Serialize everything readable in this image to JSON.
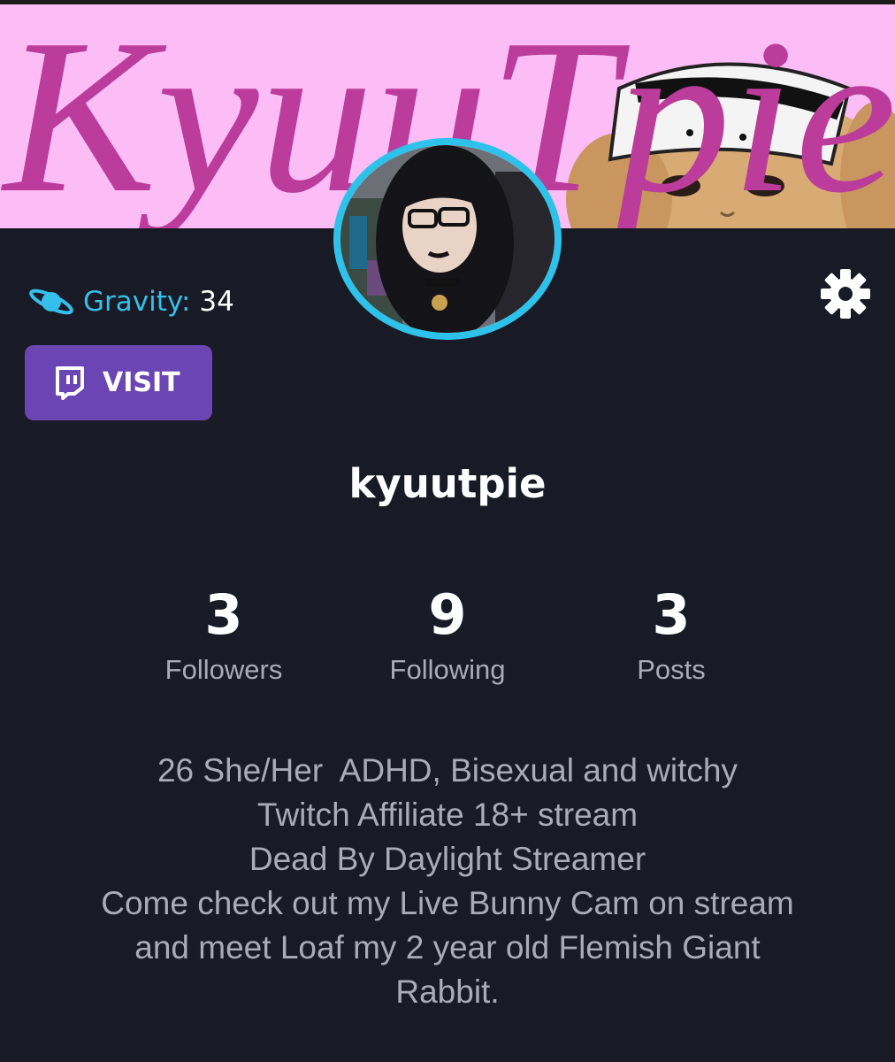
{
  "banner": {
    "text": "KyuuTpie",
    "background": "#fcbdf6",
    "text_color": "#bb3c9b"
  },
  "profile": {
    "gravity_icon": "planet-icon",
    "gravity_label": "Gravity:",
    "gravity_value": "34",
    "settings_icon": "gear-icon",
    "visit_icon": "twitch-icon",
    "visit_label": "VISIT",
    "username": "kyuutpie"
  },
  "stats": [
    {
      "value": "3",
      "label": "Followers"
    },
    {
      "value": "9",
      "label": "Following"
    },
    {
      "value": "3",
      "label": "Posts"
    }
  ],
  "bio": {
    "lines": [
      "26 She/Her  ADHD, Bisexual and witchy",
      "Twitch Affiliate 18+ stream",
      "Dead By Daylight Streamer",
      "Come check out my Live Bunny Cam on stream",
      "and meet Loaf my 2 year old Flemish Giant",
      "Rabbit."
    ]
  },
  "colors": {
    "background": "#181a26",
    "accent": "#2ec2ea",
    "visit_button": "#6b45b4",
    "muted_text": "#a9abb8"
  }
}
